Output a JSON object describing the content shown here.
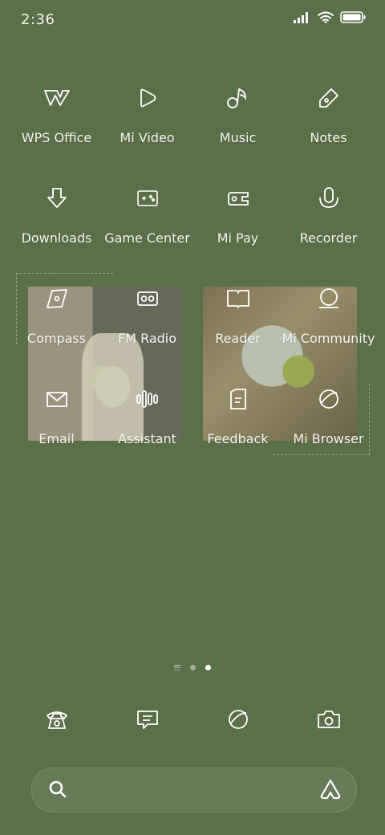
{
  "status_bar": {
    "time": "2:36"
  },
  "home_rows": [
    [
      {
        "label": "WPS Office",
        "icon": "wps-icon"
      },
      {
        "label": "Mi Video",
        "icon": "play-icon"
      },
      {
        "label": "Music",
        "icon": "music-note-icon"
      },
      {
        "label": "Notes",
        "icon": "pencil-icon"
      }
    ],
    [
      {
        "label": "Downloads",
        "icon": "download-icon"
      },
      {
        "label": "Game Center",
        "icon": "gamepad-icon"
      },
      {
        "label": "Mi Pay",
        "icon": "wallet-icon"
      },
      {
        "label": "Recorder",
        "icon": "microphone-icon"
      }
    ],
    [
      {
        "label": "Compass",
        "icon": "compass-icon"
      },
      {
        "label": "FM Radio",
        "icon": "radio-icon"
      },
      {
        "label": "Reader",
        "icon": "book-icon"
      },
      {
        "label": "Mi Community",
        "icon": "community-icon"
      }
    ],
    [
      {
        "label": "Email",
        "icon": "mail-icon"
      },
      {
        "label": "Assistant",
        "icon": "voice-bars-icon"
      },
      {
        "label": "Feedback",
        "icon": "feedback-icon"
      },
      {
        "label": "Mi Browser",
        "icon": "browser-icon"
      }
    ]
  ],
  "dock": [
    {
      "name": "Phone",
      "icon": "phone-icon"
    },
    {
      "name": "Messages",
      "icon": "message-icon"
    },
    {
      "name": "Browser",
      "icon": "browser-icon"
    },
    {
      "name": "Camera",
      "icon": "camera-icon"
    }
  ],
  "pager": {
    "pages": 2,
    "current": 2
  },
  "search": {
    "placeholder": ""
  },
  "colors": {
    "background": "#5a704a",
    "foreground": "#f4f6ef"
  }
}
